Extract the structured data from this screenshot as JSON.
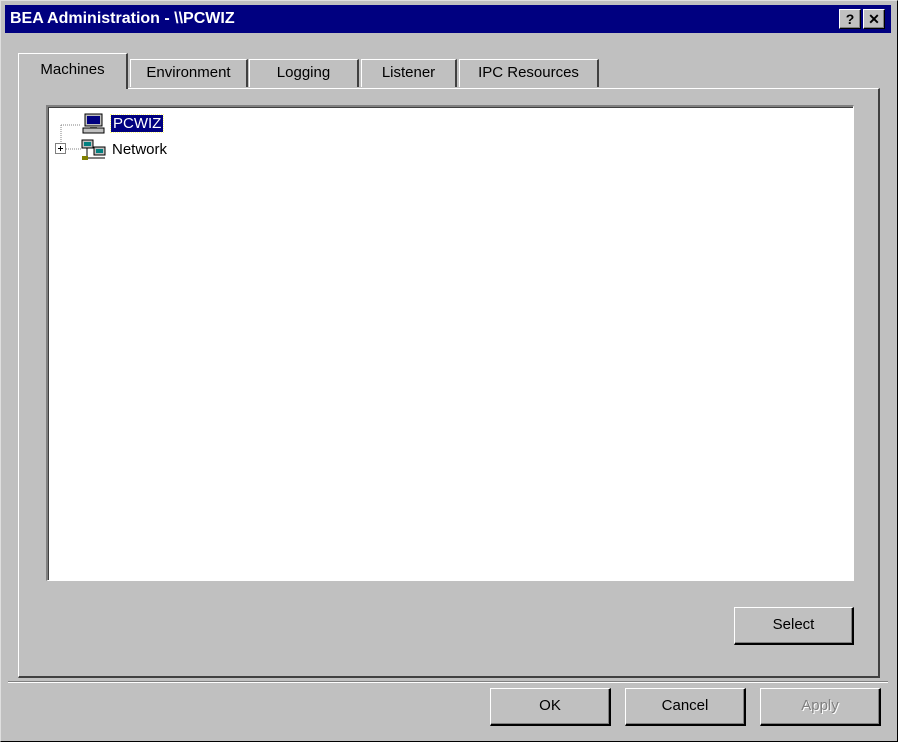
{
  "window": {
    "title": "BEA Administration - \\\\PCWIZ",
    "help_label": "?",
    "close_label": "✕"
  },
  "tabs": [
    {
      "label": "Machines"
    },
    {
      "label": "Environment"
    },
    {
      "label": "Logging"
    },
    {
      "label": "Listener"
    },
    {
      "label": "IPC Resources"
    }
  ],
  "tree": {
    "nodes": [
      {
        "label": "PCWIZ",
        "icon": "computer-icon",
        "selected": true
      },
      {
        "label": "Network",
        "icon": "network-icon",
        "expander": "+"
      }
    ]
  },
  "buttons": {
    "select": "Select",
    "ok": "OK",
    "cancel": "Cancel",
    "apply": "Apply"
  },
  "colors": {
    "titlebar": "#000080",
    "selection": "#000080",
    "face": "#c0c0c0"
  }
}
